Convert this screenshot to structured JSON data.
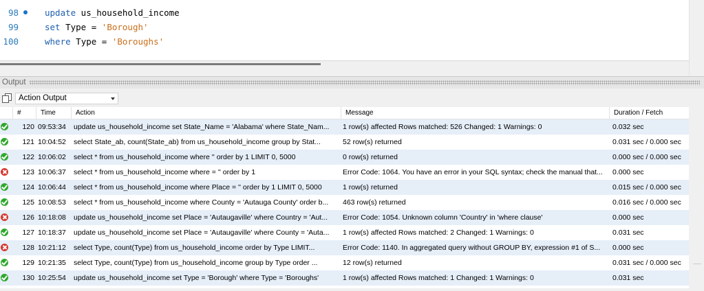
{
  "editor": {
    "lines": [
      {
        "num": "98",
        "kw": "update",
        "rest": " us_household_income",
        "str": "",
        "tail": ""
      },
      {
        "num": "99",
        "kw": "set",
        "rest": " Type = ",
        "str": "'Borough'",
        "tail": ""
      },
      {
        "num": "100",
        "kw": "where",
        "rest": " Type = ",
        "str": "'Boroughs'",
        "tail": ""
      }
    ]
  },
  "output": {
    "title": "Output",
    "selector_value": "Action Output",
    "columns": [
      "#",
      "Time",
      "Action",
      "Message",
      "Duration / Fetch"
    ],
    "rows": [
      {
        "status": "ok",
        "num": "120",
        "time": "09:53:34",
        "action": "update us_household_income  set State_Name = 'Alabama'  where State_Nam...",
        "message": "1 row(s) affected Rows matched: 526  Changed: 1  Warnings: 0",
        "duration": "0.032 sec"
      },
      {
        "status": "ok",
        "num": "121",
        "time": "10:04:52",
        "action": "select State_ab,    count(State_ab) from us_household_income  group by Stat...",
        "message": "52 row(s) returned",
        "duration": "0.031 sec / 0.000 sec"
      },
      {
        "status": "ok",
        "num": "122",
        "time": "10:06:02",
        "action": "select * from us_household_income  where '' order by 1 LIMIT 0, 5000",
        "message": "0 row(s) returned",
        "duration": "0.000 sec / 0.000 sec"
      },
      {
        "status": "err",
        "num": "123",
        "time": "10:06:37",
        "action": "select * from us_household_income  where = ''  order by 1",
        "message": "Error Code: 1064. You have an error in your SQL syntax; check the manual that...",
        "duration": "0.000 sec"
      },
      {
        "status": "ok",
        "num": "124",
        "time": "10:06:44",
        "action": "select * from us_household_income  where Place = ''  order by 1 LIMIT 0, 5000",
        "message": "1 row(s) returned",
        "duration": "0.015 sec / 0.000 sec"
      },
      {
        "status": "ok",
        "num": "125",
        "time": "10:08:53",
        "action": "select * from us_household_income  where County = 'Autauga County'  order b...",
        "message": "463 row(s) returned",
        "duration": "0.016 sec / 0.000 sec"
      },
      {
        "status": "err",
        "num": "126",
        "time": "10:18:08",
        "action": "update us_household_income  set Place = 'Autaugaville'  where Country = 'Aut...",
        "message": "Error Code: 1054. Unknown column 'Country' in 'where clause'",
        "duration": "0.000 sec"
      },
      {
        "status": "ok",
        "num": "127",
        "time": "10:18:37",
        "action": "update us_household_income  set Place = 'Autaugaville'  where County = 'Auta...",
        "message": "1 row(s) affected Rows matched: 2  Changed: 1  Warnings: 0",
        "duration": "0.031 sec"
      },
      {
        "status": "err",
        "num": "128",
        "time": "10:21:12",
        "action": "select Type,        count(Type) from us_household_income order by Type LIMIT...",
        "message": "Error Code: 1140. In aggregated query without GROUP BY, expression #1 of S...",
        "duration": "0.000 sec"
      },
      {
        "status": "ok",
        "num": "129",
        "time": "10:21:35",
        "action": "select Type,        count(Type) from us_household_income group by Type order ...",
        "message": "12 row(s) returned",
        "duration": "0.031 sec / 0.000 sec"
      },
      {
        "status": "ok",
        "num": "130",
        "time": "10:25:54",
        "action": "update us_household_income set Type = 'Borough' where Type = 'Boroughs'",
        "message": "1 row(s) affected Rows matched: 1  Changed: 1  Warnings: 0",
        "duration": "0.031 sec"
      }
    ]
  }
}
